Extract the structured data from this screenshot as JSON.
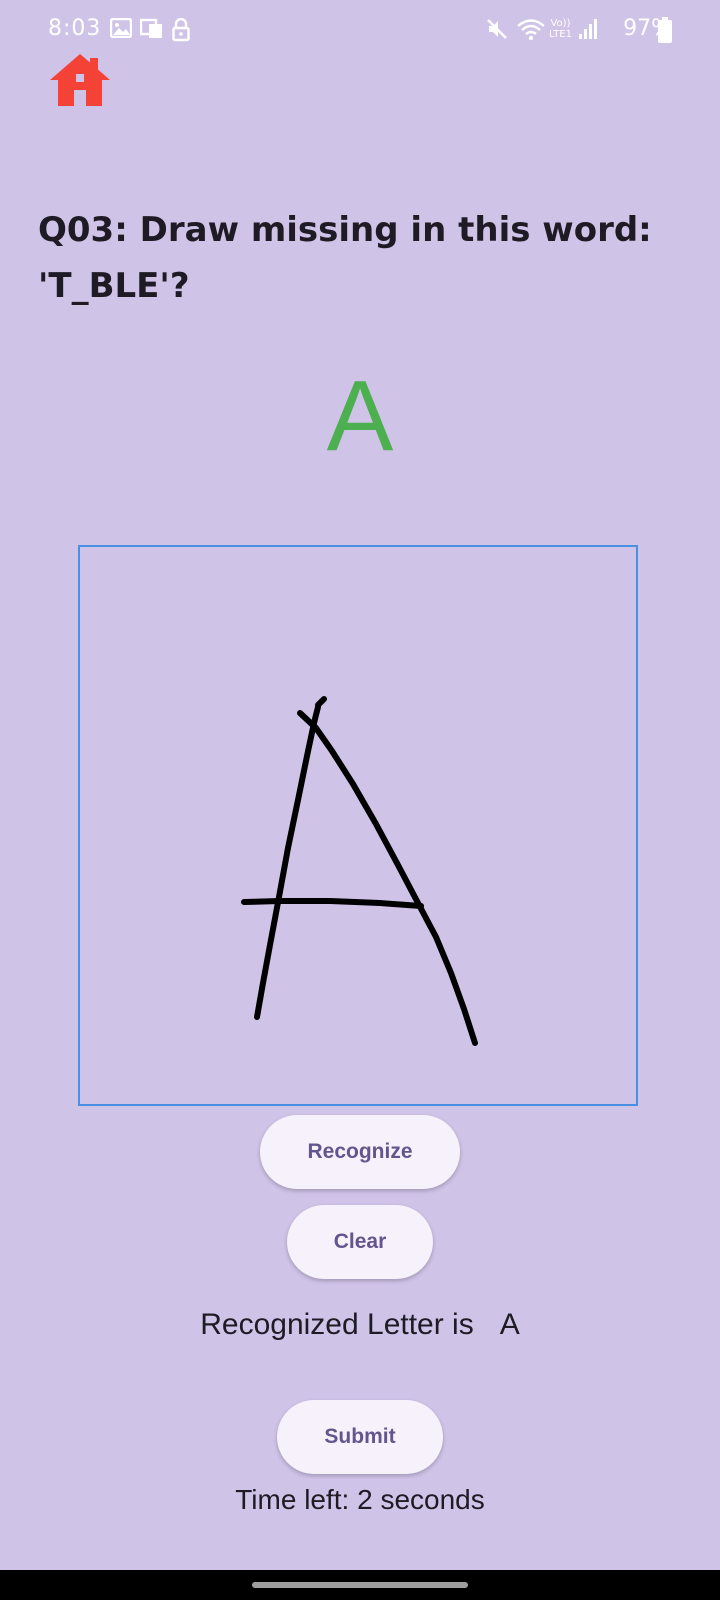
{
  "status_bar": {
    "time": "8:03",
    "network_label_top": "Vo))",
    "network_label_bottom": "LTE1",
    "battery": "97%",
    "icons": [
      "image-icon",
      "cast-icon",
      "lock-icon",
      "mute-icon",
      "wifi-icon",
      "signal-icon",
      "battery-icon"
    ]
  },
  "header": {
    "home_icon": "home-icon",
    "home_color": "#f44336"
  },
  "question": {
    "line1": "Q03: Draw missing in this word:",
    "line2": "'T_BLE'?"
  },
  "target": {
    "letter": "A",
    "color": "#4caf50"
  },
  "canvas": {
    "border_color": "#4a90e2",
    "stroke_color": "#000000"
  },
  "buttons": {
    "recognize": "Recognize",
    "clear": "Clear",
    "submit": "Submit"
  },
  "result": {
    "label": "Recognized Letter is",
    "letter": "A"
  },
  "timer": {
    "text": "Time left: 2 seconds"
  },
  "colors": {
    "background": "#d0c3e8",
    "button_bg": "#f6f1fa",
    "button_text": "#65558f"
  }
}
